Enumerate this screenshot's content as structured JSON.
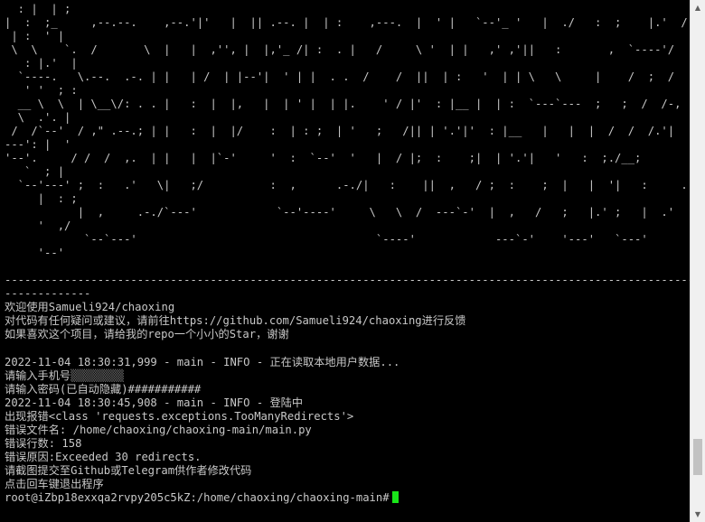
{
  "terminal": {
    "banner_lines": [
      "  : |  | ;",
      "|  :  ;_     ,--.--.    ,--.'|'   |  || .--. |  | :    ,---.  |  ' |   `--'_ '   |  ./   :  ;    |.'  / |",
      " | :  ' |",
      " \\  \\    `.  /       \\  |   |  ,'', |  |,'_ /| :  . |   /     \\ '  | |   ,' ,'||   :       ,  `----'/  ;  :",
      "   : |.'  |",
      "  `----.   \\.--.  .-. | |   | /  | |--'|  ' | |  . .  /    /  ||  | :   '  | | \\   \\     |    /  ;  /   |",
      "   ' '  ; :",
      "  __ \\  \\  | \\__\\/: . . |   :  |  |,   |  | ' |  | |.    ' / |'  : |__ |  | :  `---`---  ;   ;  /  /-,  \\",
      "  \\  .'. |",
      " /  /`--'  / ,\" .--.; | |   :  |  |/    :  | : ;  | '   ;   /|| | '.'|'  : |__   |   |  |  /  /  /.'|   `",
      "---': |  '",
      "'--'.     / /  /  ,.  | |   |  |`-'     '  :  `--'  '   |  / |;  :    ;|  | '.'|   '   :  ;./__;       :",
      "   `  ; |",
      "  `--'---' ;  :   .'   \\|   ;/          :  ,      .-./|   :    ||  ,   / ;  :    ;  |   |  '|   :     .'",
      "     |  : ;",
      "           |  ,     .-./`---'            `--'----'     \\   \\  /  ---`-'  |  ,   /   ;   |.' ;   |  .'",
      "     '  ,/",
      "            `--`---'                                    `----'            ---`-'    '---'   `---'",
      "     '--'"
    ],
    "separator_1": "----------------------------------------------------------------------------------------------------------",
    "separator_2": "-------------",
    "welcome_line": "欢迎使用Samueli924/chaoxing",
    "feedback_line": "对代码有任何疑问或建议，请前往https://github.com/Samueli924/chaoxing进行反馈",
    "star_line": "如果喜欢这个项目，请给我的repo一个小小的Star，谢谢",
    "log_reading": "2022-11-04 18:30:31,999 - main - INFO - 正在读取本地用户数据...",
    "phone_prompt": "请输入手机号",
    "phone_masked": "▒▒▒▒▒▒▒▒",
    "password_prompt": "请输入密码(已自动隐藏)###########",
    "log_login": "2022-11-04 18:30:45,908 - main - INFO - 登陆中",
    "error_type": "出现报错<class 'requests.exceptions.TooManyRedirects'>",
    "error_file": "错误文件名: /home/chaoxing/chaoxing-main/main.py",
    "error_line": "错误行数: 158",
    "error_reason": "错误原因:Exceeded 30 redirects.",
    "error_report": "请截图提交至Github或Telegram供作者修改代码",
    "exit_prompt": "点击回车键退出程序",
    "shell_prompt": "root@iZbp18exxqa2rvpy205c5kZ:/home/chaoxing/chaoxing-main#",
    "cursor_color": "#19e619"
  },
  "scrollbar": {
    "up_icon": "▲",
    "down_icon": "▼",
    "position_fraction": 0.93
  }
}
